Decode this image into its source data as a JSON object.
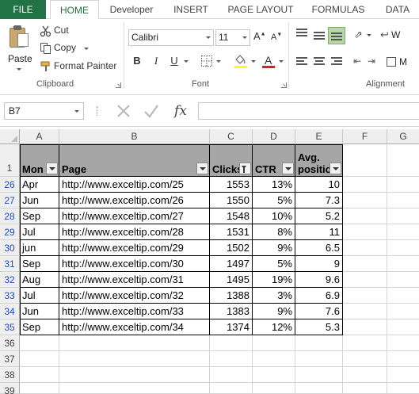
{
  "ribbon_tabs": {
    "file": "FILE",
    "home": "HOME",
    "developer": "Developer",
    "insert": "INSERT",
    "page_layout": "PAGE LAYOUT",
    "formulas": "FORMULAS",
    "data": "DATA"
  },
  "clipboard": {
    "paste": "Paste",
    "cut": "Cut",
    "copy": "Copy",
    "format_painter": "Format Painter",
    "group_label": "Clipboard"
  },
  "font": {
    "name": "Calibri",
    "size": "11",
    "group_label": "Font",
    "bold": "B",
    "italic": "I",
    "underline": "U",
    "font_color": "A",
    "font_color_hex": "#e02020",
    "fill_color_hex": "#ffff00"
  },
  "alignment": {
    "group_label": "Alignment",
    "wrap_partial": "W",
    "merge_partial": "M"
  },
  "formula_bar": {
    "name_box": "B7",
    "fx": "fx",
    "formula": ""
  },
  "columns": [
    "A",
    "B",
    "C",
    "D",
    "E",
    "F",
    "G"
  ],
  "header_row": {
    "row_number": "1",
    "month": "Mon",
    "page": "Page",
    "clicks": "Clicks",
    "ctr": "CTR",
    "avg_position": "Avg. positio"
  },
  "rows": [
    {
      "row": "26",
      "month": "Apr",
      "page": "http://www.exceltip.com/25",
      "clicks": "1553",
      "ctr": "13%",
      "avg": "10"
    },
    {
      "row": "27",
      "month": "Jun",
      "page": "http://www.exceltip.com/26",
      "clicks": "1550",
      "ctr": "5%",
      "avg": "7.3"
    },
    {
      "row": "28",
      "month": "Sep",
      "page": "http://www.exceltip.com/27",
      "clicks": "1548",
      "ctr": "10%",
      "avg": "5.2"
    },
    {
      "row": "29",
      "month": "Jul",
      "page": "http://www.exceltip.com/28",
      "clicks": "1531",
      "ctr": "8%",
      "avg": "11"
    },
    {
      "row": "30",
      "month": "jun",
      "page": "http://www.exceltip.com/29",
      "clicks": "1502",
      "ctr": "9%",
      "avg": "6.5"
    },
    {
      "row": "31",
      "month": "Sep",
      "page": "http://www.exceltip.com/30",
      "clicks": "1497",
      "ctr": "5%",
      "avg": "9"
    },
    {
      "row": "32",
      "month": "Aug",
      "page": "http://www.exceltip.com/31",
      "clicks": "1495",
      "ctr": "19%",
      "avg": "9.6"
    },
    {
      "row": "33",
      "month": "Jul",
      "page": "http://www.exceltip.com/32",
      "clicks": "1388",
      "ctr": "3%",
      "avg": "6.9"
    },
    {
      "row": "34",
      "month": "Jun",
      "page": "http://www.exceltip.com/33",
      "clicks": "1383",
      "ctr": "9%",
      "avg": "7.6"
    },
    {
      "row": "35",
      "month": "Sep",
      "page": "http://www.exceltip.com/34",
      "clicks": "1374",
      "ctr": "12%",
      "avg": "5.3"
    }
  ],
  "empty_rows": [
    "36",
    "37",
    "38",
    "39"
  ]
}
